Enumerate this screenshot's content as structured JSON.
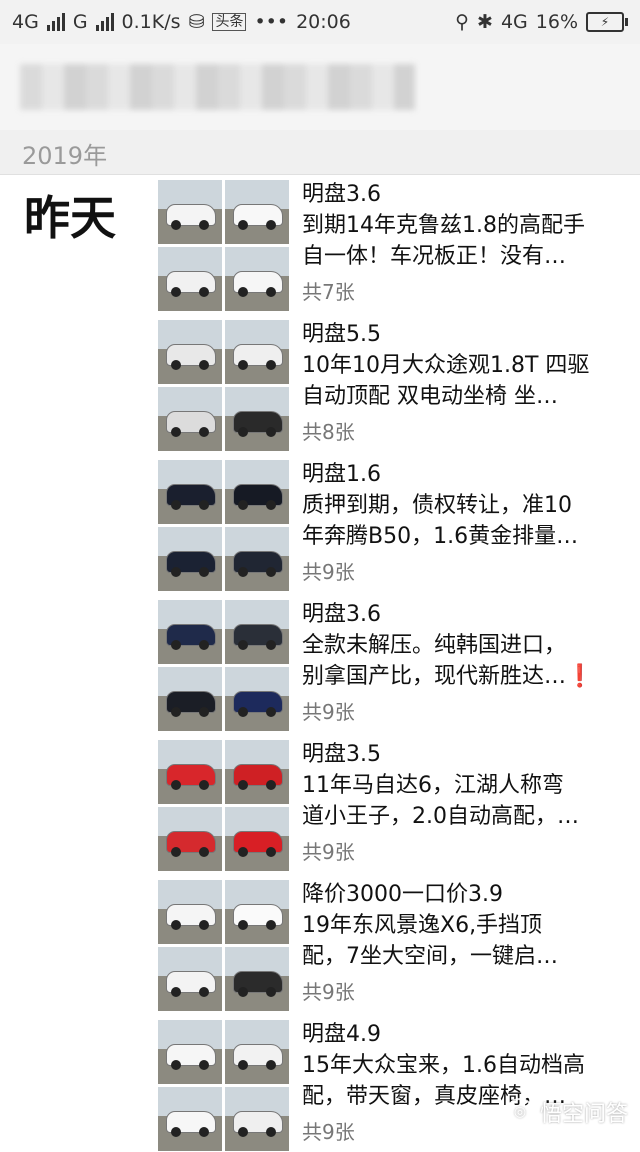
{
  "status_bar": {
    "net1": "4G",
    "net2": "G",
    "speed": "0.1K/s",
    "app_badge": "头条",
    "more": "•••",
    "time": "20:06",
    "net3": "4G",
    "battery": "16%"
  },
  "header": {
    "year": "2019年"
  },
  "day_label": "昨天",
  "posts": [
    {
      "title": "明盘3.6",
      "desc1": "到期14年克鲁兹1.8的高配手",
      "desc2": "自一体！车况板正！没有…",
      "count": "共7张",
      "colors": [
        "#f4f4f4",
        "#f8f8f8",
        "#f1f1f1",
        "#f6f6f6"
      ]
    },
    {
      "title": "明盘5.5",
      "desc1": "10年10月大众途观1.8T 四驱",
      "desc2": "自动顶配 双电动坐椅 坐…",
      "count": "共8张",
      "colors": [
        "#e8e8e8",
        "#efefef",
        "#dcdcdc",
        "#2a2a2a"
      ]
    },
    {
      "title": "明盘1.6",
      "desc1": " 质押到期，债权转让，准10",
      "desc2": "年奔腾B50，1.6黄金排量…",
      "count": "共9张",
      "colors": [
        "#1a1f2e",
        "#161a24",
        "#1b2233",
        "#202633"
      ]
    },
    {
      "title": "明盘3.6",
      "desc1": "全款未解压。纯韩国进口，",
      "desc2": "别拿国产比，现代新胜达…",
      "excl": "❗",
      "count": "共9张",
      "colors": [
        "#1f2a4a",
        "#2a2f38",
        "#1b1e26",
        "#1d2a5c"
      ]
    },
    {
      "title": "明盘3.5",
      "desc1": "11年马自达6，江湖人称弯",
      "desc2": "道小王子，2.0自动高配，…",
      "count": "共9张",
      "colors": [
        "#d8262b",
        "#cf2024",
        "#d52a2e",
        "#d81f25"
      ]
    },
    {
      "title": "降价3000一口价3.9",
      "desc1": "19年东风景逸X6,手挡顶",
      "desc2": "配，7坐大空间，一键启…",
      "count": "共9张",
      "colors": [
        "#f5f5f5",
        "#fafafa",
        "#f3f3f3",
        "#2b2b2b"
      ]
    },
    {
      "title": "明盘4.9",
      "desc1": "15年大众宝来，1.6自动档高",
      "desc2": "配，带天窗，真皮座椅，…",
      "count": "共9张",
      "colors": [
        "#f6f6f6",
        "#f2f2f2",
        "#f7f7f7",
        "#efefef"
      ]
    }
  ],
  "watermark": "悟空问答"
}
